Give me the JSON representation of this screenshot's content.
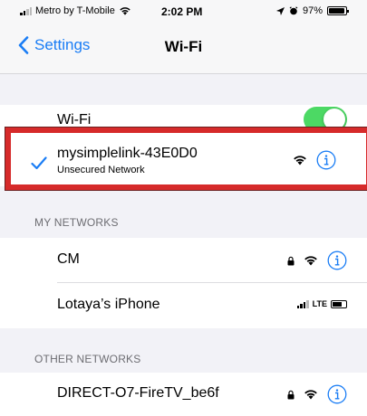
{
  "status_bar": {
    "carrier": "Metro by T-Mobile",
    "time": "2:02 PM",
    "battery": "97%",
    "battery_level": 0.97
  },
  "nav": {
    "back_label": "Settings",
    "title": "Wi-Fi"
  },
  "wifi_toggle": {
    "label": "Wi-Fi",
    "on": true
  },
  "connected": {
    "name": "mysimplelink-43E0D0",
    "subtitle": "Unsecured Network"
  },
  "my_networks": {
    "header": "MY NETWORKS",
    "items": [
      {
        "name": "CM",
        "locked": true,
        "icon": "wifi-icon"
      },
      {
        "name": "Lotaya’s iPhone",
        "hotspot": "LTE"
      }
    ]
  },
  "other_networks": {
    "header": "OTHER NETWORKS",
    "items": [
      {
        "name": "DIRECT-O7-FireTV_be6f",
        "locked": true
      }
    ]
  },
  "colors": {
    "accent": "#1a7df5",
    "toggle_on": "#4cd964",
    "highlight": "#d62a2a"
  }
}
